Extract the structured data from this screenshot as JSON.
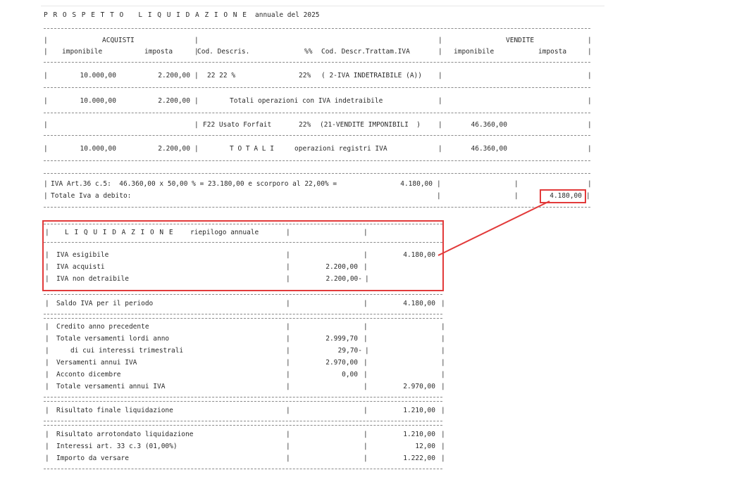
{
  "report": {
    "title": "P R O S P E T T O   L I Q U I D A Z I O N E",
    "subtitle": "annuale del 2025"
  },
  "header": {
    "acquisti": "ACQUISTI",
    "vendite": "VENDITE",
    "imponibile": "imponibile",
    "imposta": "imposta",
    "cod_descris": "Cod. Descris.",
    "perc": "%%",
    "cod_descr_trattam": "Cod. Descr.Trattam.IVA",
    "imponibile_v": "imponibile",
    "imposta_v": "imposta"
  },
  "rows": {
    "r1": {
      "imponibile": "10.000,00",
      "imposta": "2.200,00",
      "cod": "22 22 %",
      "perc": "22%",
      "tratt": "( 2-IVA INDETRAIBILE (A))"
    },
    "r2": {
      "imponibile": "10.000,00",
      "imposta": "2.200,00",
      "label": "Totali operazioni con IVA indetraibile"
    },
    "r3": {
      "cod": "F22 Usato Forfait",
      "perc": "22%",
      "tratt": "(21-VENDITE IMPONIBILI  )",
      "imponibile_v": "46.360,00"
    },
    "r4": {
      "imponibile": "10.000,00",
      "imposta": "2.200,00",
      "label_big": "T O T A L I",
      "label": "operazioni registri IVA",
      "imponibile_v": "46.360,00"
    }
  },
  "iva_art": {
    "line": "IVA Art.36 c.5:  46.360,00 x 50,00 % = 23.180,00 e scorporo al 22,00% =",
    "value": "4.180,00",
    "totale_label": "Totale Iva a debito:",
    "totale_value": "4.180,00"
  },
  "liquidazione": {
    "title": "L I Q U I D A Z I O N E",
    "subtitle": "riepilogo annuale",
    "iva_esigibile": {
      "label": "IVA esigibile",
      "value": "4.180,00"
    },
    "iva_acquisti": {
      "label": "IVA acquisti",
      "value": "2.200,00"
    },
    "iva_non_detraibile": {
      "label": "IVA non detraibile",
      "value": "2.200,00-"
    }
  },
  "saldo": {
    "label": "Saldo IVA per il periodo",
    "value": "4.180,00"
  },
  "versamenti": {
    "credito": {
      "label": "Credito anno precedente"
    },
    "totale_lordi": {
      "label": "Totale versamenti lordi anno",
      "value": "2.999,70"
    },
    "interessi_trim": {
      "label": "di cui interessi trimestrali",
      "value": "29,70-"
    },
    "versamenti_annui": {
      "label": "Versamenti annui IVA",
      "value": "2.970,00"
    },
    "acconto": {
      "label": "Acconto dicembre",
      "value": "0,00"
    },
    "totale_annui": {
      "label": "Totale versamenti annui IVA",
      "value": "2.970,00"
    }
  },
  "risultato": {
    "label": "Risultato finale liquidazione",
    "value": "1.210,00"
  },
  "finale": {
    "arrotondato": {
      "label": "Risultato arrotondato liquidazione",
      "value": "1.210,00"
    },
    "interessi": {
      "label": "Interessi art. 33 c.3 (01,00%)",
      "value": "12,00"
    },
    "importo": {
      "label": "Importo da versare",
      "value": "1.222,00"
    }
  },
  "colors": {
    "highlight": "#e23a3a",
    "text": "#2a2a2a"
  }
}
